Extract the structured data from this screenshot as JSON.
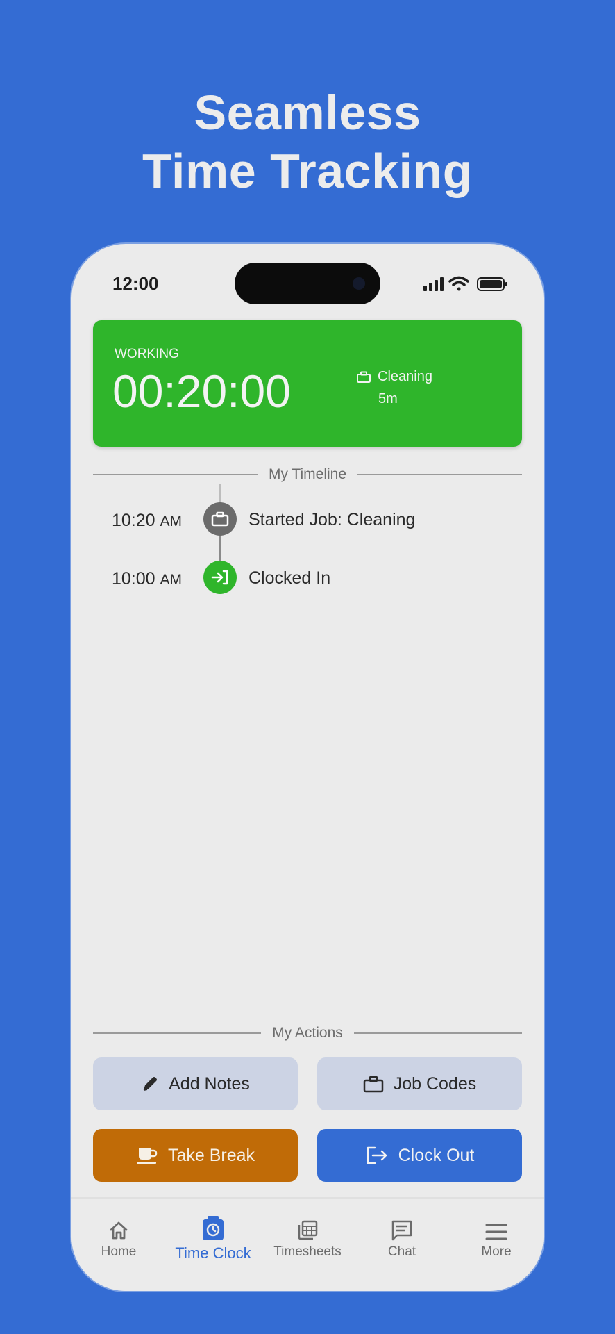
{
  "headline": {
    "line1": "Seamless",
    "line2": "Time Tracking"
  },
  "status_bar": {
    "time": "12:00"
  },
  "work_card": {
    "status": "WORKING",
    "timer": "00:20:00",
    "job_name": "Cleaning",
    "job_duration": "5m",
    "color": "#2fb52b"
  },
  "timeline": {
    "title": "My Timeline",
    "entries": [
      {
        "time": "10:20",
        "ampm": "AM",
        "label": "Started Job: Cleaning",
        "icon": "briefcase-icon"
      },
      {
        "time": "10:00",
        "ampm": "AM",
        "label": "Clocked In",
        "icon": "clock-in-icon"
      }
    ]
  },
  "actions": {
    "title": "My Actions",
    "add_notes": "Add Notes",
    "job_codes": "Job Codes",
    "take_break": "Take Break",
    "clock_out": "Clock Out"
  },
  "nav": {
    "items": [
      {
        "label": "Home",
        "icon": "home-icon"
      },
      {
        "label": "Time Clock",
        "icon": "time-clock-icon"
      },
      {
        "label": "Timesheets",
        "icon": "timesheets-icon"
      },
      {
        "label": "Chat",
        "icon": "chat-icon"
      },
      {
        "label": "More",
        "icon": "menu-icon"
      }
    ],
    "active": "Time Clock"
  },
  "colors": {
    "background": "#346cd3",
    "accent": "#346cd3",
    "working": "#2fb52b",
    "break": "#c06b07"
  }
}
